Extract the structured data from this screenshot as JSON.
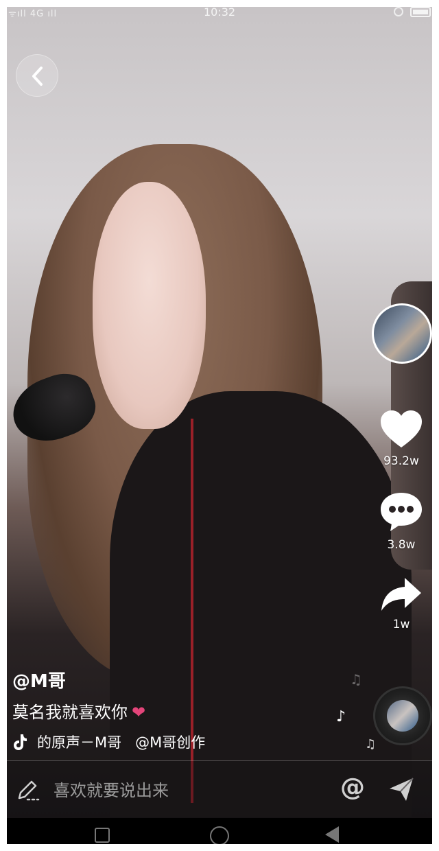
{
  "status_bar": {
    "signal": "ᯤıll 4G ıll",
    "time": "10:32"
  },
  "actions": {
    "like_count": "93.2w",
    "comment_count": "3.8w",
    "share_count": "1w"
  },
  "video_info": {
    "username": "@M哥",
    "caption": "莫名我就喜欢你",
    "caption_emoji": "❤",
    "music_label": "的原声－M哥",
    "creator_tag": "@M哥创作"
  },
  "comment_bar": {
    "placeholder": "喜欢就要说出来",
    "at_symbol": "@"
  },
  "colors": {
    "heart_emoji": "#e4457a",
    "text_primary": "#ffffff"
  },
  "icons": [
    "back-arrow-icon",
    "like-heart-icon",
    "comment-bubble-icon",
    "share-arrow-icon",
    "tiktok-note-icon",
    "music-note-icon",
    "pen-icon",
    "at-icon",
    "send-icon"
  ]
}
